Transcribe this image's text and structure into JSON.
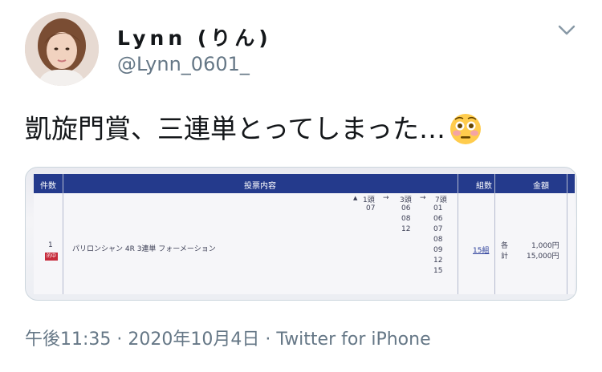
{
  "user": {
    "display_name": "Lynn (りん)",
    "handle": "@Lynn_0601_"
  },
  "tweet": {
    "text": "凱旋門賞、三連単とってしまった…",
    "emoji": "flushed-face-emoji"
  },
  "ticket": {
    "header": {
      "count": "件数",
      "content": "投票内容",
      "kumi": "組数",
      "amount": "金額"
    },
    "row": {
      "count": "1",
      "badge": "的中",
      "description": "パリロンシャン 4R 3連単 フォーメーション",
      "col1_label": "1頭",
      "col2_label": "3頭",
      "col3_label": "7頭",
      "arrow": "→",
      "col1": [
        "07"
      ],
      "col2": [
        "06",
        "08",
        "12"
      ],
      "col3": [
        "01",
        "06",
        "07",
        "08",
        "09",
        "12",
        "15"
      ],
      "kumi": "15組",
      "each_label": "各",
      "each_amount": "1,000円",
      "total_label": "計",
      "total_amount": "15,000円"
    }
  },
  "meta": {
    "time": "午後11:35",
    "sep": "·",
    "date": "2020年10月4日",
    "source": "Twitter for iPhone"
  },
  "colors": {
    "text": "#14171a",
    "secondary": "#657786",
    "ticket_header": "#243a8c",
    "badge": "#c62b3b"
  }
}
